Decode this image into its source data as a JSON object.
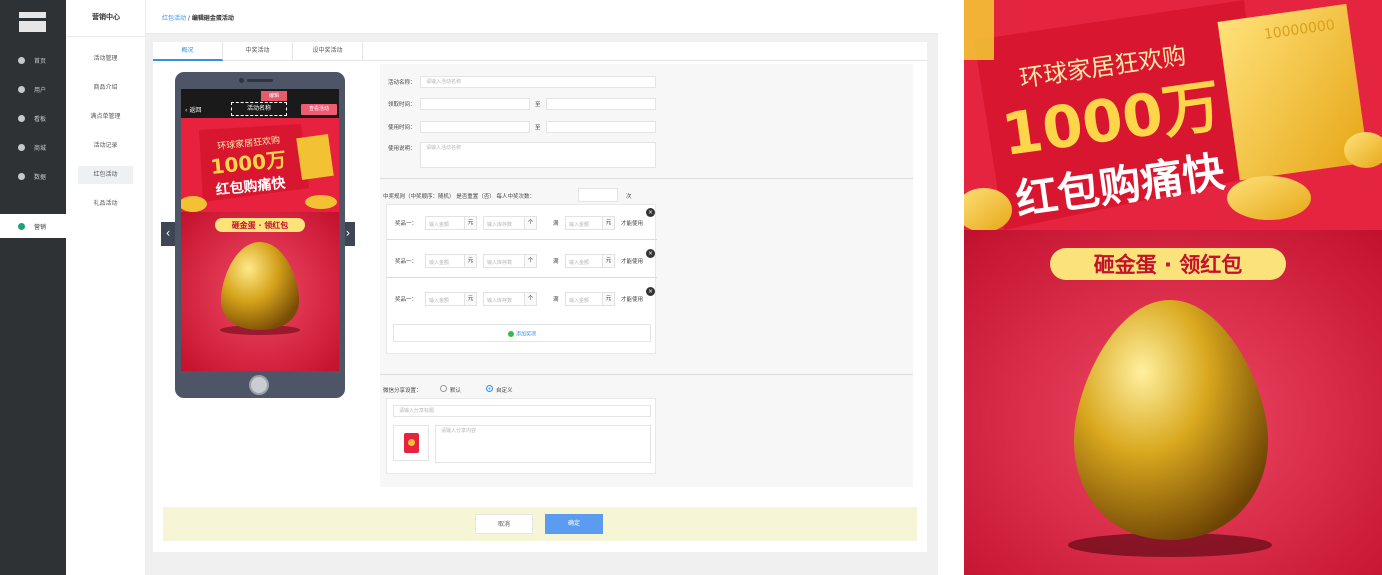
{
  "colors": {
    "sidebar_bg": "#2f3235",
    "accent_blue": "#3a8ee6",
    "poster_red": "#d21d3c",
    "gold": "#f2c234",
    "footer_bg": "#f6f6d6"
  },
  "sidebar": {
    "items": [
      {
        "label": "首页",
        "icon": "home-icon"
      },
      {
        "label": "用户",
        "icon": "user-icon"
      },
      {
        "label": "看板",
        "icon": "dashboard-icon"
      },
      {
        "label": "商城",
        "icon": "shop-icon"
      },
      {
        "label": "数据",
        "icon": "chart-icon"
      },
      {
        "label": "营销",
        "icon": "marketing-icon",
        "active": true
      }
    ]
  },
  "subnav": {
    "title": "营销中心",
    "items": [
      {
        "label": "活动管理"
      },
      {
        "label": "商品介绍"
      },
      {
        "label": "满点单管理"
      },
      {
        "label": "活动记录"
      },
      {
        "label": "红包活动",
        "active": true
      },
      {
        "label": "礼品活动"
      }
    ]
  },
  "breadcrumb": {
    "link": "红包活动",
    "sep": " / ",
    "current": "编辑砸金蛋活动"
  },
  "tabs": [
    {
      "label": "概况",
      "active": true
    },
    {
      "label": "中奖活动"
    },
    {
      "label": "设中奖活动"
    }
  ],
  "phone": {
    "back_label": "返回",
    "title": "活动名称",
    "edit_tag": "编辑",
    "pill": "查看活动",
    "banner_line1": "环球家居狂欢购",
    "banner_line2": "1000万",
    "banner_line3": "红包购痛快",
    "ribbon": "砸金蛋 · 领红包"
  },
  "form": {
    "name_label": "活动名称：",
    "name_placeholder": "请输入活动名称",
    "receive_label": "领取时间：",
    "use_label": "使用时间：",
    "to": "至",
    "rules_label": "使用说明：",
    "rules_placeholder": "请输入活动名称",
    "prize_info": "中奖规则（中奖顺序：随机）  是否重置（否）  每人中奖次数：",
    "times_unit": "次",
    "prizes": [
      {
        "label": "奖品一：",
        "amount_ph": "输入金额",
        "unit": "元",
        "count_ph": "输入库存数",
        "count_unit": "个",
        "full_label": "满",
        "full_ph": "输入金额",
        "full_unit": "元",
        "usable": "才能使用"
      },
      {
        "label": "奖品一：",
        "amount_ph": "输入金额",
        "unit": "元",
        "count_ph": "输入库存数",
        "count_unit": "个",
        "full_label": "满",
        "full_ph": "输入金额",
        "full_unit": "元",
        "usable": "才能使用"
      },
      {
        "label": "奖品一：",
        "amount_ph": "输入金额",
        "unit": "元",
        "count_ph": "输入库存数",
        "count_unit": "个",
        "full_label": "满",
        "full_ph": "输入金额",
        "full_unit": "元",
        "usable": "才能使用"
      }
    ],
    "add_prize": "添加奖项",
    "share_label": "微信分享设置：",
    "share_default": "默认",
    "share_custom": "自定义",
    "share_title_ph": "请输入分享标题",
    "share_desc_ph": "请输入分享内容"
  },
  "footer": {
    "cancel": "取消",
    "ok": "确定"
  },
  "poster": {
    "banner_line1": "环球家居狂欢购",
    "banner_line2": "1000万",
    "banner_line3": "红包购痛快",
    "ticket": "10000000",
    "ribbon": "砸金蛋 · 领红包"
  }
}
